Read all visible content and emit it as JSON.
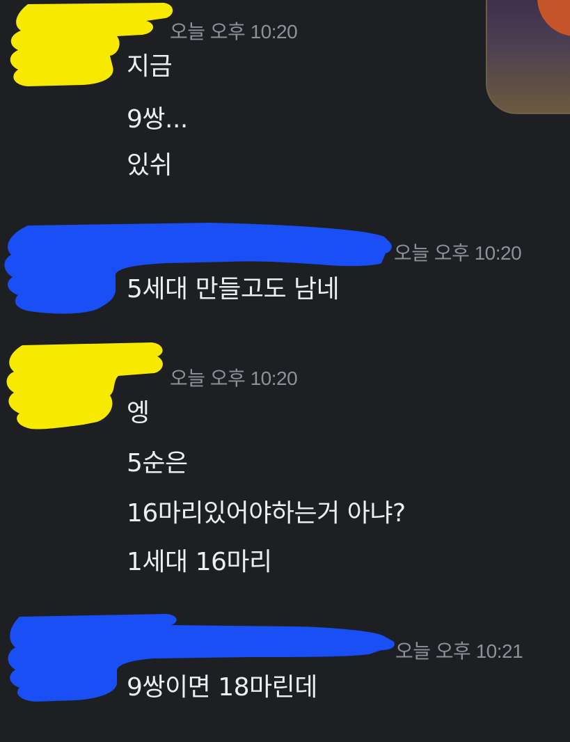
{
  "messages": [
    {
      "time": "오늘 오후 10:20",
      "lines": [
        "지금",
        "9쌍...",
        "있쉬"
      ]
    },
    {
      "time": "오늘 오후 10:20",
      "lines": [
        "5세대 만들고도 남네"
      ]
    },
    {
      "time": "오늘 오후 10:20",
      "lines": [
        "엥",
        "5순은",
        "16마리있어야하는거 아냐?",
        "1세대 16마리"
      ]
    },
    {
      "time": "오늘 오후 10:21",
      "lines": [
        "9쌍이면 18마린데"
      ]
    }
  ],
  "colors": {
    "background": "#1e1f23",
    "text": "#eceef1",
    "timestamp": "#8e9199",
    "redact_yellow": "#f7ea00",
    "redact_blue": "#1a4ff5"
  }
}
